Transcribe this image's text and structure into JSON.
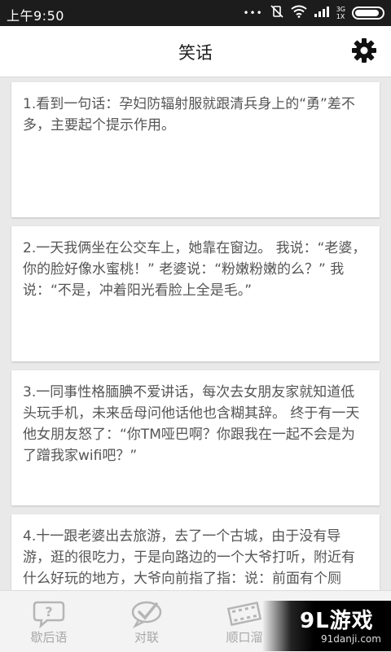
{
  "status_bar": {
    "time": "上午9:50",
    "network_top": "3G",
    "network_bottom": "1X",
    "battery_level": 0.9
  },
  "header": {
    "title": "笑话",
    "settings_icon": "gear-icon"
  },
  "jokes": [
    "1.看到一句话：孕妇防辐射服就跟清兵身上的“勇”差不多，主要起个提示作用。",
    "2.一天我俩坐在公交车上，她靠在窗边。 我说：“老婆，你的脸好像水蜜桃！” 老婆说：“粉嫩粉嫩的么？” 我说：“不是，冲着阳光看脸上全是毛。”",
    "3.一同事性格腼腆不爱讲话，每次去女朋友家就知道低头玩手机，未来岳母问他话他也含糊其辞。 终于有一天他女朋友怒了：“你TM哑巴啊？你跟我在一起不会是为了蹭我家wifi吧？”",
    "4.十一跟老婆出去旅游，去了一个古城，由于没有导游，逛的很吃力，于是向路边的一个大爷打听，附近有什么好玩的地方，大爷向前指了指：说：前面有个厕吧。"
  ],
  "bottom_nav": [
    {
      "label": "歇后语",
      "icon": "speech-bubble-question-icon"
    },
    {
      "label": "对联",
      "icon": "check-bubble-icon"
    },
    {
      "label": "顺口溜",
      "icon": "film-icon"
    },
    {
      "label": "",
      "icon": "tab-icon"
    }
  ],
  "watermark": {
    "brand": "9L游戏",
    "site": "91danji.com"
  },
  "colors": {
    "status_bar_bg": "#1c1c1c",
    "page_bg": "#e9e9e9",
    "card_bg": "#ffffff",
    "text": "#555555",
    "nav_text": "#a8a8a8"
  }
}
